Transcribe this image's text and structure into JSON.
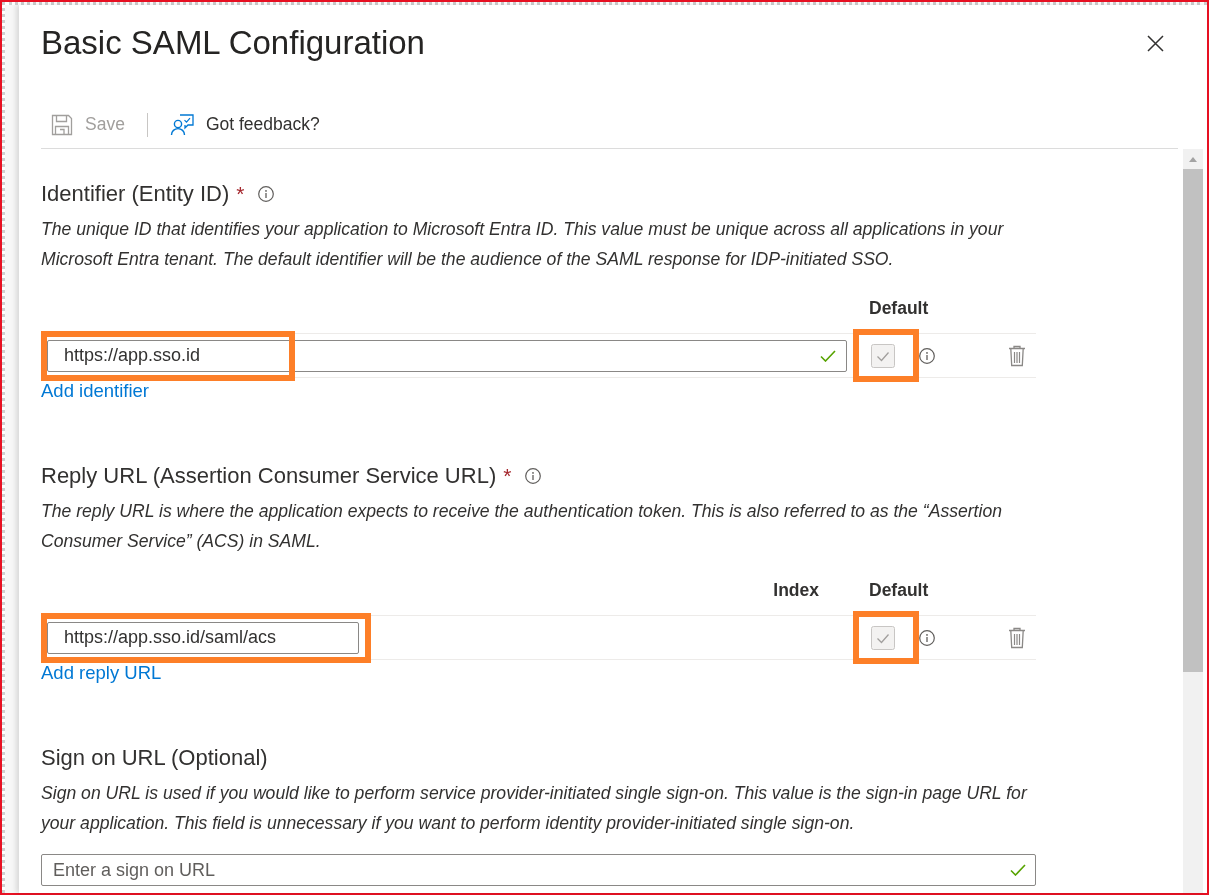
{
  "panel": {
    "title": "Basic SAML Configuration"
  },
  "toolbar": [
    {
      "kind": "save",
      "label": "Save",
      "disabled": true
    },
    {
      "kind": "feedback",
      "label": "Got feedback?",
      "disabled": false
    }
  ],
  "sections": [
    {
      "title": "Identifier (Entity ID)",
      "required_mark": "*",
      "description": "The unique ID that identifies your application to Microsoft Entra ID. This value must be unique across all applications in your Microsoft Entra tenant. The default identifier will be the audience of the SAML response for IDP-initiated SSO.",
      "columns": [
        {
          "kind": "default",
          "label": "Default"
        }
      ],
      "rows": [
        {
          "value": "https://app.sso.id",
          "valid": true,
          "value_highlighted": true,
          "default_checked": true,
          "default_disabled": true,
          "default_highlighted": true
        }
      ],
      "add_link": "Add identifier"
    },
    {
      "title": "Reply URL (Assertion Consumer Service URL)",
      "required_mark": "*",
      "description": "The reply URL is where the application expects to receive the authentication token. This is also referred to as the “Assertion Consumer Service” (ACS) in SAML.",
      "columns": [
        {
          "kind": "index",
          "label": "Index"
        },
        {
          "kind": "default",
          "label": "Default"
        }
      ],
      "rows": [
        {
          "value": "https://app.sso.id/saml/acs",
          "valid": false,
          "value_highlighted": true,
          "default_checked": true,
          "default_disabled": true,
          "default_highlighted": true
        }
      ],
      "add_link": "Add reply URL"
    },
    {
      "title": "Sign on URL (Optional)",
      "description": "Sign on URL is used if you would like to perform service provider-initiated single sign-on. This value is the sign-in page URL for your application. This field is unnecessary if you want to perform identity provider-initiated single sign-on.",
      "field": {
        "placeholder": "Enter a sign on URL",
        "valid": true
      }
    }
  ]
}
